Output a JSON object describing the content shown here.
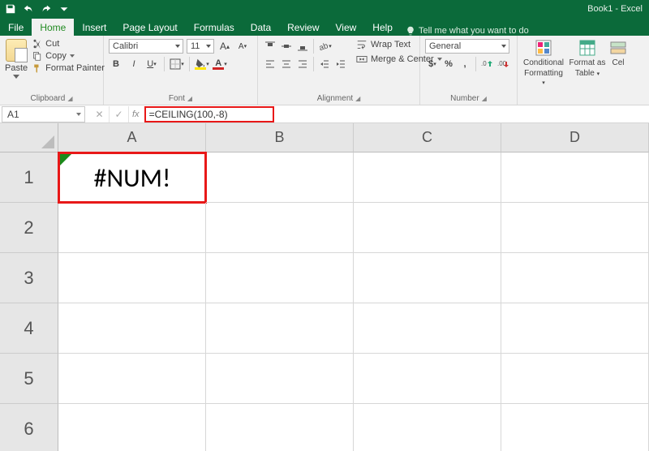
{
  "title": "Book1 - Excel",
  "tabs": {
    "file": "File",
    "home": "Home",
    "insert": "Insert",
    "pagelayout": "Page Layout",
    "formulas": "Formulas",
    "data": "Data",
    "review": "Review",
    "view": "View",
    "help": "Help",
    "tellme": "Tell me what you want to do"
  },
  "clipboard": {
    "paste": "Paste",
    "cut": "Cut",
    "copy": "Copy",
    "formatpainter": "Format Painter",
    "label": "Clipboard"
  },
  "font": {
    "name": "Calibri",
    "size": "11",
    "label": "Font"
  },
  "alignment": {
    "wrap": "Wrap Text",
    "merge": "Merge & Center",
    "label": "Alignment"
  },
  "number": {
    "format": "General",
    "label": "Number"
  },
  "styles": {
    "conditional_l1": "Conditional",
    "conditional_l2": "Formatting",
    "formatas_l1": "Format as",
    "formatas_l2": "Table",
    "cell_l1": "Cel"
  },
  "namebox": "A1",
  "formula": "=CEILING(100,-8)",
  "columns": [
    "A",
    "B",
    "C",
    "D"
  ],
  "rows": [
    "1",
    "2",
    "3",
    "4",
    "5",
    "6"
  ],
  "cell_a1": "#NUM!",
  "chart_data": {
    "type": "table",
    "columns": [
      "A",
      "B",
      "C",
      "D"
    ],
    "rows": [
      [
        "#NUM!",
        "",
        "",
        ""
      ],
      [
        "",
        "",
        "",
        ""
      ],
      [
        "",
        "",
        "",
        ""
      ],
      [
        "",
        "",
        "",
        ""
      ],
      [
        "",
        "",
        "",
        ""
      ],
      [
        "",
        "",
        "",
        ""
      ]
    ]
  }
}
